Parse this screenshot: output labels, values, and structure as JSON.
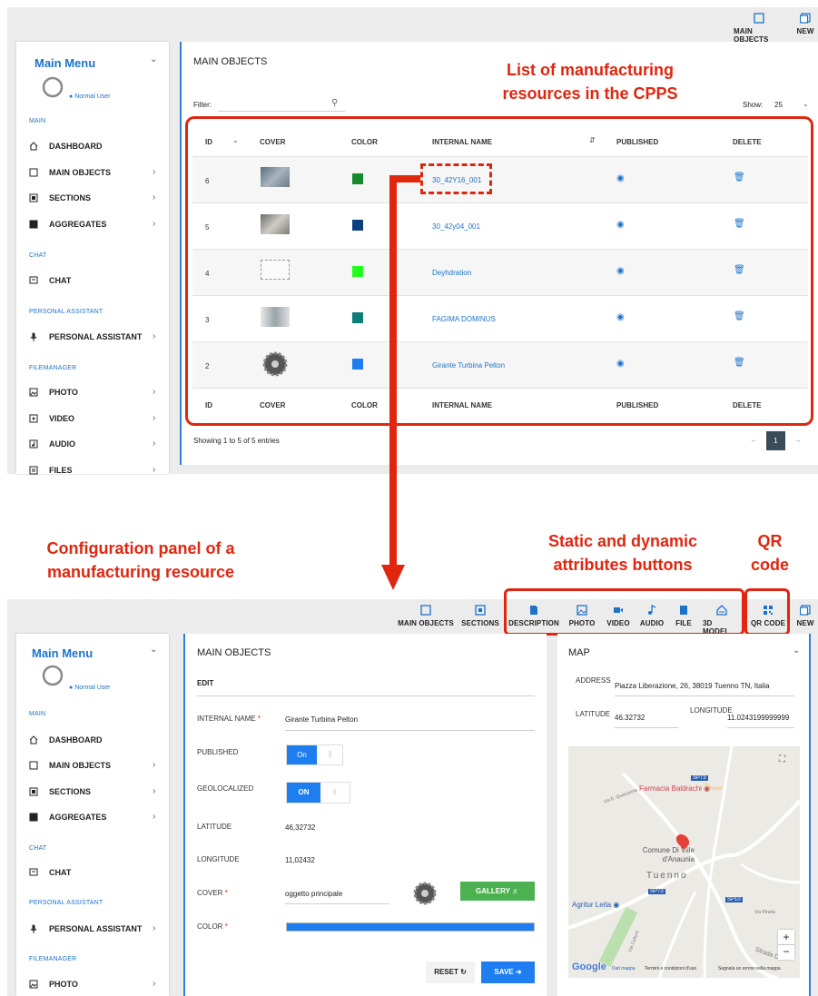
{
  "top": {
    "toolbar": [
      {
        "label": "MAIN OBJECTS",
        "icon": "square-icon"
      },
      {
        "label": "NEW",
        "icon": "new-icon"
      }
    ],
    "sidebar": {
      "title": "Main Menu",
      "user": "Normal User",
      "sections": [
        {
          "header": "MAIN",
          "items": [
            "DASHBOARD",
            "MAIN OBJECTS",
            "SECTIONS",
            "AGGREGATES"
          ]
        },
        {
          "header": "CHAT",
          "items": [
            "CHAT"
          ]
        },
        {
          "header": "PERSONAL ASSISTANT",
          "items": [
            "PERSONAL ASSISTANT"
          ]
        },
        {
          "header": "FILEMANAGER",
          "items": [
            "PHOTO",
            "VIDEO",
            "AUDIO",
            "FILES"
          ]
        }
      ]
    },
    "main": {
      "title": "MAIN OBJECTS",
      "filter_label": "Filter:",
      "show_label": "Show:",
      "show_value": "25",
      "columns": [
        "ID",
        "COVER",
        "COLOR",
        "INTERNAL NAME",
        "PUBLISHED",
        "DELETE"
      ],
      "rows": [
        {
          "id": "6",
          "color": "#168a2e",
          "name": "30_42Y16_001"
        },
        {
          "id": "5",
          "color": "#0d3f7e",
          "name": "30_42y04_001"
        },
        {
          "id": "4",
          "color": "#22ff1c",
          "name": "Deyhdration"
        },
        {
          "id": "3",
          "color": "#0f7c78",
          "name": "FAGIMA DOMINUS"
        },
        {
          "id": "2",
          "color": "#1e7ef0",
          "name": "Girante Turbina Pelton"
        }
      ],
      "footer": "Showing 1 to 5 of 5 entries",
      "page": "1"
    }
  },
  "annotations": {
    "list": "List of manufacturing resources in the CPPS",
    "config": "Configuration panel of a manufacturing resource",
    "static": "Static and dynamic attributes buttons",
    "qr": "QR code"
  },
  "bottom": {
    "toolbar": [
      {
        "label": "MAIN OBJECTS",
        "icon": "square-icon"
      },
      {
        "label": "SECTIONS",
        "icon": "sections-icon"
      },
      {
        "label": "DESCRIPTION",
        "icon": "description-icon"
      },
      {
        "label": "PHOTO",
        "icon": "photo-icon"
      },
      {
        "label": "VIDEO",
        "icon": "video-icon"
      },
      {
        "label": "AUDIO",
        "icon": "audio-icon"
      },
      {
        "label": "FILE",
        "icon": "file-icon"
      },
      {
        "label": "3D MODEL",
        "icon": "model-icon"
      },
      {
        "label": "QR CODE",
        "icon": "qr-icon"
      },
      {
        "label": "NEW",
        "icon": "new-icon"
      }
    ],
    "sidebar": {
      "title": "Main Menu",
      "user": "Normal User",
      "sections": [
        {
          "header": "MAIN",
          "items": [
            "DASHBOARD",
            "MAIN OBJECTS",
            "SECTIONS",
            "AGGREGATES"
          ]
        },
        {
          "header": "CHAT",
          "items": [
            "CHAT"
          ]
        },
        {
          "header": "PERSONAL ASSISTANT",
          "items": [
            "PERSONAL ASSISTANT"
          ]
        },
        {
          "header": "FILEMANAGER",
          "items": [
            "PHOTO"
          ]
        }
      ]
    },
    "form": {
      "title": "MAIN OBJECTS",
      "edit": "EDIT",
      "internal_name_label": "INTERNAL NAME",
      "internal_name": "Girante Turbina Pelton",
      "published_label": "PUBLISHED",
      "published_toggle": "On",
      "geo_label": "GEOLOCALIZED",
      "geo_toggle": "ON",
      "lat_label": "LATITUDE",
      "lat": "46,32732",
      "lon_label": "LONGITUDE",
      "lon": "11,02432",
      "cover_label": "COVER",
      "cover": "oggetto principale",
      "gallery": "GALLERY",
      "color_label": "COLOR",
      "color": "#1e7ef0",
      "reset": "RESET",
      "save": "SAVE",
      "required": "*"
    },
    "map": {
      "title": "MAP",
      "address_label": "ADDRESS",
      "address": "Piazza Liberazione, 26, 38019 Tuenno TN, Italia",
      "lat_label": "LATITUDE",
      "lat": "46.32732",
      "lon_label": "LONGITUDE",
      "lon": "11.0243199999999",
      "places": {
        "farmacia": "Farmacia Baldrachi",
        "comune": "Comune Di Ville d'Anaunia",
        "town": "Tuenno",
        "agritur": "Agritur Leita",
        "sp73a": "SP73",
        "sp73b": "SP73",
        "sp10": "SP10",
        "road1": "Via E. Quaresima",
        "road2": "Via Cultura",
        "road3": "Via Pineta",
        "road4": "Strada D"
      },
      "google": "Google",
      "dati": "Dati mappa",
      "terms": "Termini e condizioni d'uso",
      "report": "Segnala un errore nella mappa"
    }
  }
}
